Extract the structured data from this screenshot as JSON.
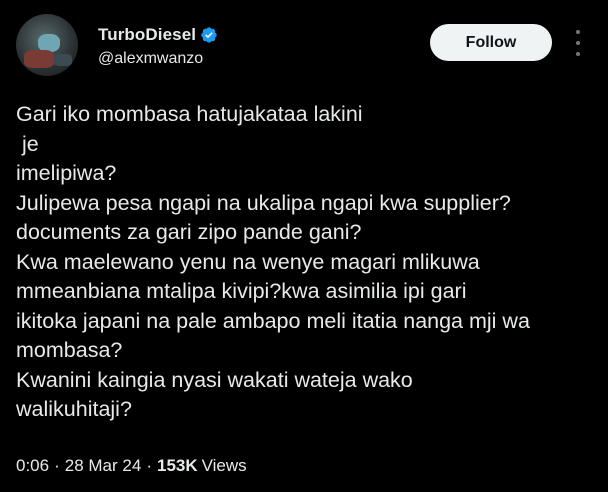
{
  "author": {
    "display_name": "TurboDiesel",
    "handle": "@alexmwanzo",
    "verified_icon": "verified-badge-icon",
    "verified_color": "#1d9bf0"
  },
  "follow_label": "Follow",
  "tweet": {
    "lines": [
      "Gari iko mombasa hatujakataa lakini",
      " je",
      "imelipiwa?",
      "Julipewa pesa ngapi na ukalipa ngapi kwa supplier?",
      "documents za gari zipo pande gani?",
      "Kwa maelewano yenu na wenye magari mlikuwa",
      "mmeanbiana mtalipa kivipi?kwa asimilia ipi gari",
      "ikitoka japani na pale ambapo meli itatia nanga mji wa",
      "mombasa?",
      "Kwanini kaingia nyasi wakati wateja wako",
      "walikuhitaji?"
    ]
  },
  "meta": {
    "time": "0:06",
    "separator": "·",
    "date": "28 Mar 24",
    "views_count": "153K",
    "views_label": "Views"
  },
  "colors": {
    "background": "#000000",
    "text": "#e7e9ea",
    "muted": "#71767b",
    "follow_bg": "#eff3f4"
  }
}
